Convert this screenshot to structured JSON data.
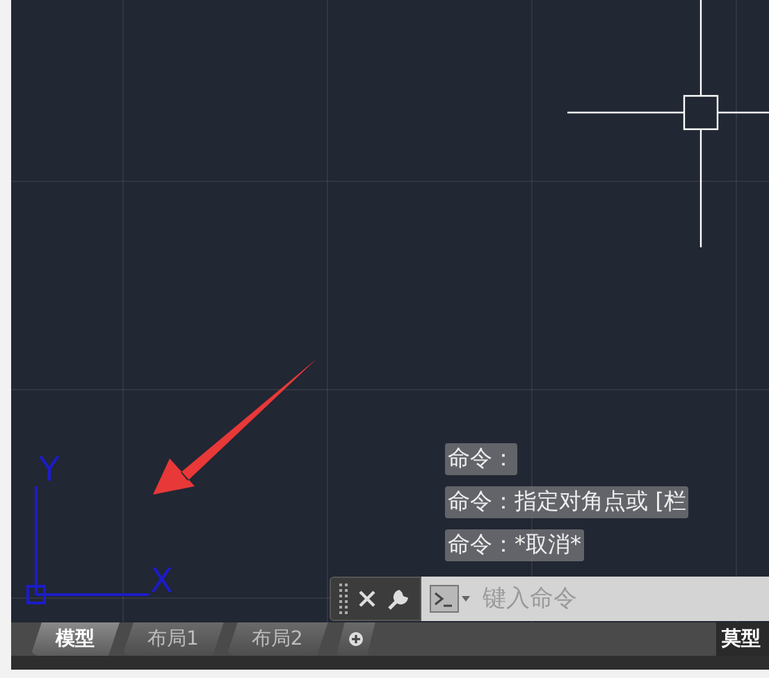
{
  "ucs": {
    "y_label": "Y",
    "x_label": "X"
  },
  "command_history": [
    {
      "text": "命令："
    },
    {
      "text": "命令：指定对角点或 [栏"
    },
    {
      "text": "命令：*取消*"
    }
  ],
  "command_line": {
    "placeholder": "键入命令"
  },
  "layout_tabs": [
    {
      "label": "模型",
      "selected": true
    },
    {
      "label": "布局1",
      "selected": false
    },
    {
      "label": "布局2",
      "selected": false
    }
  ],
  "status_bar": {
    "label": "莫型"
  }
}
